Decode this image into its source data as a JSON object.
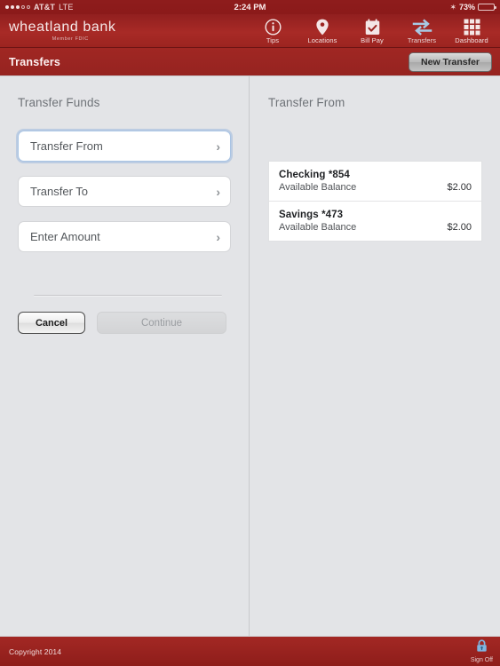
{
  "status_bar": {
    "carrier": "AT&T",
    "network": "LTE",
    "time": "2:24 PM",
    "bluetooth_icon": "bluetooth-icon",
    "battery_percent": "73%",
    "battery_level": 73,
    "signal_dots_filled": 3,
    "signal_dots_total": 5
  },
  "header": {
    "logo_name": "wheatland bank",
    "logo_tagline": "Member FDIC",
    "nav": [
      {
        "label": "Tips",
        "icon": "info-circle-icon",
        "active": false
      },
      {
        "label": "Locations",
        "icon": "map-pin-icon",
        "active": false
      },
      {
        "label": "Bill Pay",
        "icon": "calendar-check-icon",
        "active": false
      },
      {
        "label": "Transfers",
        "icon": "transfer-arrows-icon",
        "active": true
      },
      {
        "label": "Dashboard",
        "icon": "grid-icon",
        "active": false
      }
    ]
  },
  "subheader": {
    "title": "Transfers",
    "new_transfer_label": "New Transfer"
  },
  "left_panel": {
    "title": "Transfer Funds",
    "fields": [
      {
        "label": "Transfer From",
        "value": "",
        "focused": true,
        "chevron": "chevron-right-icon"
      },
      {
        "label": "Transfer To",
        "value": "",
        "focused": false,
        "chevron": "chevron-right-icon"
      },
      {
        "label": "Enter Amount",
        "value": "",
        "focused": false,
        "chevron": "chevron-right-icon"
      }
    ],
    "cancel_label": "Cancel",
    "continue_label": "Continue",
    "continue_disabled": true
  },
  "right_panel": {
    "title": "Transfer From",
    "balance_label": "Available Balance",
    "accounts": [
      {
        "name": "Checking *854",
        "sublabel": "Available Balance",
        "amount": "$2.00"
      },
      {
        "name": "Savings *473",
        "sublabel": "Available Balance",
        "amount": "$2.00"
      }
    ]
  },
  "footer": {
    "copyright": "Copyright 2014",
    "signoff_label": "Sign Off",
    "signoff_icon": "lock-icon"
  },
  "colors": {
    "brand_red": "#a02723",
    "dark_red": "#8e1d1a",
    "panel_bg": "#e3e4e7",
    "accent_blue": "#7fb5e0",
    "focus_blue": "#a9c4e4"
  }
}
